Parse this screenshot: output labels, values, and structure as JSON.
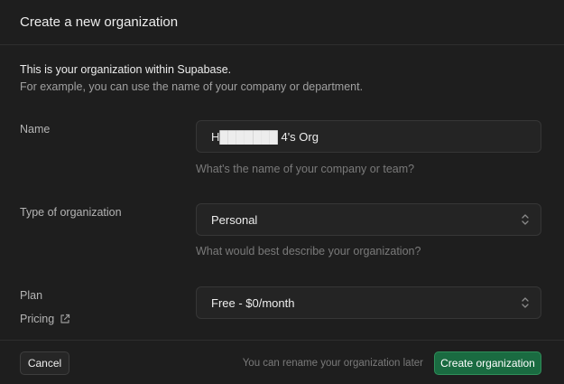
{
  "dialog": {
    "title": "Create a new organization",
    "intro_line1": "This is your organization within Supabase.",
    "intro_line2": "For example, you can use the name of your company or department."
  },
  "name_field": {
    "label": "Name",
    "value": "H███████ 4's Org",
    "hint": "What's the name of your company or team?"
  },
  "type_field": {
    "label": "Type of organization",
    "selected": "Personal",
    "hint": "What would best describe your organization?"
  },
  "plan_field": {
    "label": "Plan",
    "selected": "Free - $0/month",
    "pricing_link": "Pricing",
    "pricing_icon": "external-link-icon"
  },
  "footer": {
    "cancel_label": "Cancel",
    "note": "You can rename your organization later",
    "create_label": "Create organization"
  },
  "colors": {
    "background": "#1e1e1e",
    "brand_green": "#1a6b41"
  }
}
